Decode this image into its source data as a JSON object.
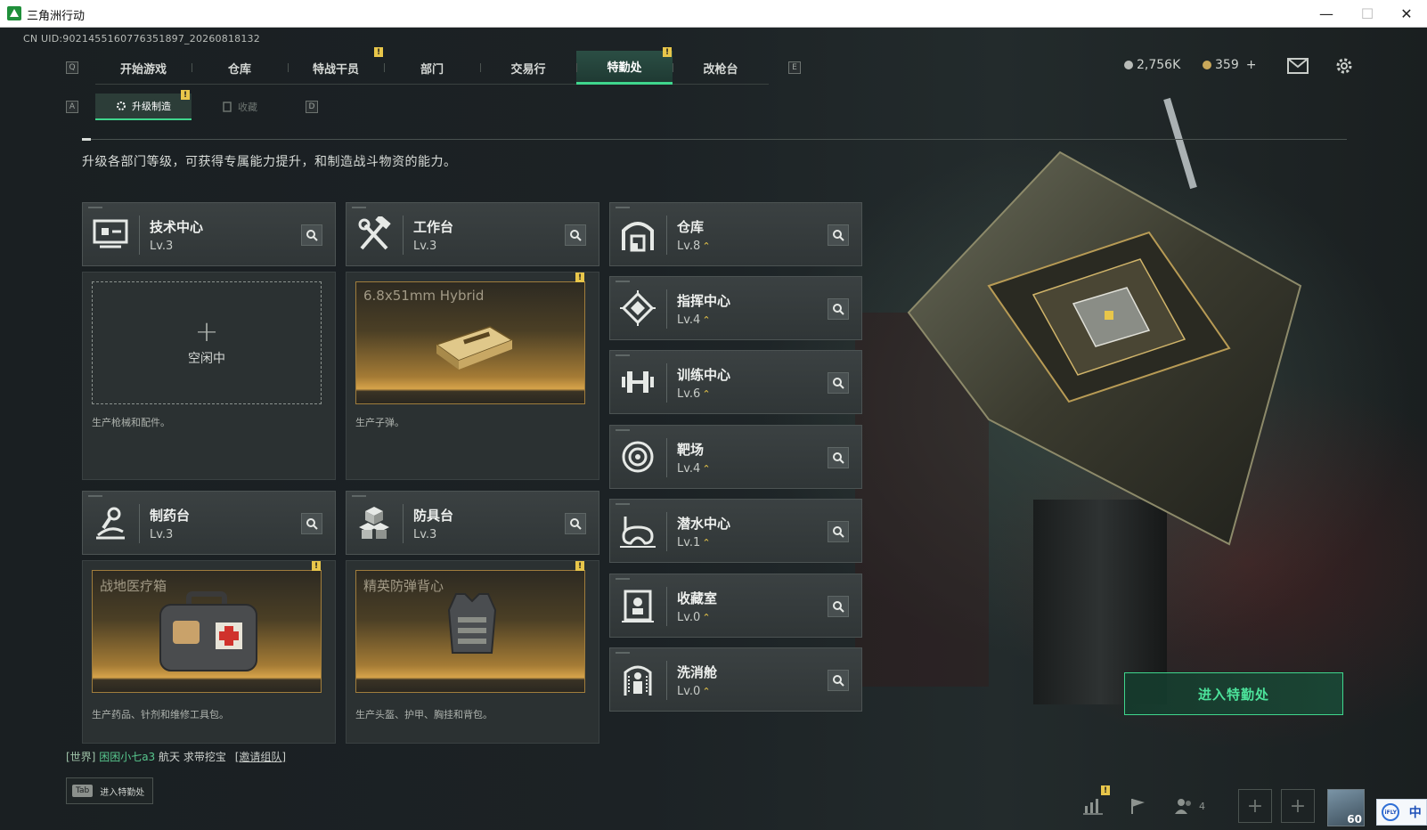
{
  "window": {
    "title": "三角洲行动",
    "controls": {
      "minimize": "—",
      "maximize": "☐",
      "close": "✕"
    }
  },
  "uid": "CN UID:9021455160776351897_20260818132",
  "key_hints": {
    "prev_tab": "Q",
    "next_tab": "E",
    "prev_sub": "A",
    "next_sub": "D"
  },
  "main_tabs": [
    {
      "label": "开始游戏",
      "active": false,
      "alert": false
    },
    {
      "label": "仓库",
      "active": false,
      "alert": false
    },
    {
      "label": "特战干员",
      "active": false,
      "alert": true
    },
    {
      "label": "部门",
      "active": false,
      "alert": false
    },
    {
      "label": "交易行",
      "active": false,
      "alert": false
    },
    {
      "label": "特勤处",
      "active": true,
      "alert": true
    },
    {
      "label": "改枪台",
      "active": false,
      "alert": false
    }
  ],
  "currency": {
    "coins": "2,756K",
    "bonds": "359",
    "add": "+"
  },
  "sub_tabs": [
    {
      "label": "升级制造",
      "active": true,
      "alert": true
    },
    {
      "label": "收藏",
      "active": false,
      "alert": false
    }
  ],
  "alert_mark": "!",
  "intro": "升级各部门等级，可获得专属能力提升，和制造战斗物资的能力。",
  "production_facilities": [
    {
      "name": "技术中心",
      "level": "Lv.3",
      "icon": "computer-icon",
      "state": "idle",
      "idle_label": "空闲中",
      "idle_plus": "+",
      "desc": "生产枪械和配件。"
    },
    {
      "name": "工作台",
      "level": "Lv.3",
      "icon": "tools-icon",
      "state": "producing",
      "product": "6.8x51mm Hybrid",
      "product_icon": "ammo-box-icon",
      "desc": "生产子弹。"
    },
    {
      "name": "制药台",
      "level": "Lv.3",
      "icon": "microscope-icon",
      "state": "producing",
      "product": "战地医疗箱",
      "product_icon": "medkit-icon",
      "desc": "生产药品、针剂和维修工具包。"
    },
    {
      "name": "防具台",
      "level": "Lv.3",
      "icon": "armor-blocks-icon",
      "state": "producing",
      "product": "精英防弹背心",
      "product_icon": "vest-icon",
      "desc": "生产头盔、护甲、胸挂和背包。"
    }
  ],
  "level_facilities": [
    {
      "name": "仓库",
      "level": "Lv.8",
      "icon": "warehouse-icon",
      "upgradable": true
    },
    {
      "name": "指挥中心",
      "level": "Lv.4",
      "icon": "chip-icon",
      "upgradable": true
    },
    {
      "name": "训练中心",
      "level": "Lv.6",
      "icon": "dumbbell-icon",
      "upgradable": true
    },
    {
      "name": "靶场",
      "level": "Lv.4",
      "icon": "target-icon",
      "upgradable": true
    },
    {
      "name": "潜水中心",
      "level": "Lv.1",
      "icon": "diving-mask-icon",
      "upgradable": true
    },
    {
      "name": "收藏室",
      "level": "Lv.0",
      "icon": "collection-icon",
      "upgradable": true
    },
    {
      "name": "洗消舱",
      "level": "Lv.0",
      "icon": "decon-icon",
      "upgradable": true
    }
  ],
  "upgrade_glyph": "⌃",
  "enter_button": "进入特勤处",
  "chat": {
    "channel": "[世界]",
    "player": "困困小七a3",
    "message": "航天 求带挖宝",
    "invite": "[邀请组队]"
  },
  "tab_hint": {
    "key": "Tab",
    "label": "进入特勤处"
  },
  "bottom_bar": {
    "friend_count": "4",
    "player_level": "60",
    "add": "+"
  },
  "ime": {
    "logo": "iFLY",
    "lang": "中"
  },
  "colors": {
    "accent": "#3fd68d",
    "alert": "#e8c64a",
    "card": "#343a3b",
    "product_glow": "#d7a44a"
  }
}
